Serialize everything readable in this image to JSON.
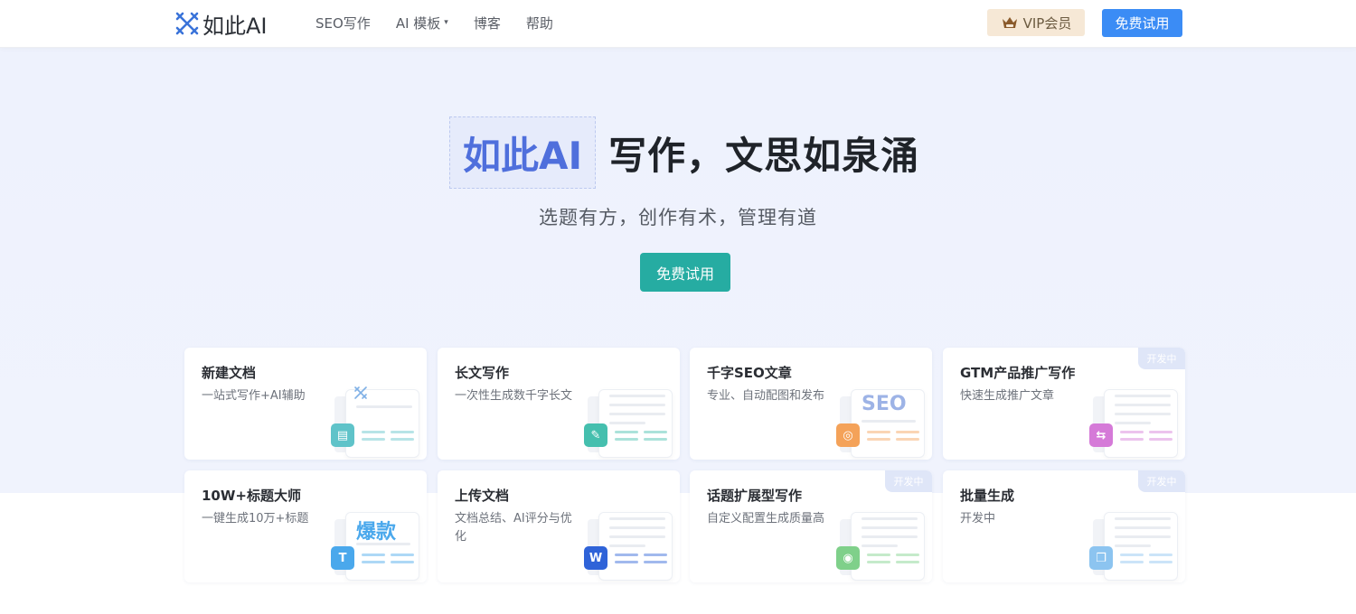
{
  "header": {
    "logo_text": "如此AI",
    "nav": [
      {
        "label": "SEO写作"
      },
      {
        "label": "AI 模板",
        "caret": "▾"
      },
      {
        "label": "博客"
      },
      {
        "label": "帮助"
      }
    ],
    "vip_label": "VIP会员",
    "trial_label": "免费试用"
  },
  "hero": {
    "brand": "如此AI",
    "slogan": "写作，文思如泉涌",
    "subtitle": "选题有方，创作有术，管理有道",
    "cta": "免费试用"
  },
  "cards": [
    {
      "title": "新建文档",
      "desc": "一站式写作+AI辅助",
      "accent": "#5fc3c9",
      "icon": "document-icon"
    },
    {
      "title": "长文写作",
      "desc": "一次性生成数千字长文",
      "accent": "#45bfae",
      "icon": "feather-icon"
    },
    {
      "title": "千字SEO文章",
      "desc": "专业、自动配图和发布",
      "accent": "#f4a259",
      "big_word": "SEO",
      "icon": "seo-icon"
    },
    {
      "title": "GTM产品推广写作",
      "desc": "快速生成推广文章",
      "accent": "#d57ad8",
      "badge": "开发中",
      "icon": "promotion-icon"
    },
    {
      "title": "10W+标题大师",
      "desc": "一键生成10万+标题",
      "accent": "#4aa8ec",
      "big_word": "爆款",
      "icon": "title-icon"
    },
    {
      "title": "上传文档",
      "desc": "文档总结、AI评分与优化",
      "accent": "#2f63d8",
      "icon": "word-icon"
    },
    {
      "title": "话题扩展型写作",
      "desc": "自定义配置生成质量高",
      "accent": "#7fd08a",
      "badge": "开发中",
      "icon": "topic-icon"
    },
    {
      "title": "批量生成",
      "desc": "开发中",
      "accent": "#8cc4f0",
      "badge": "开发中",
      "icon": "batch-icon"
    }
  ],
  "colors": {
    "primary": "#3b8cf5",
    "teal": "#26aca2",
    "brand_blue": "#4f6fdc"
  }
}
